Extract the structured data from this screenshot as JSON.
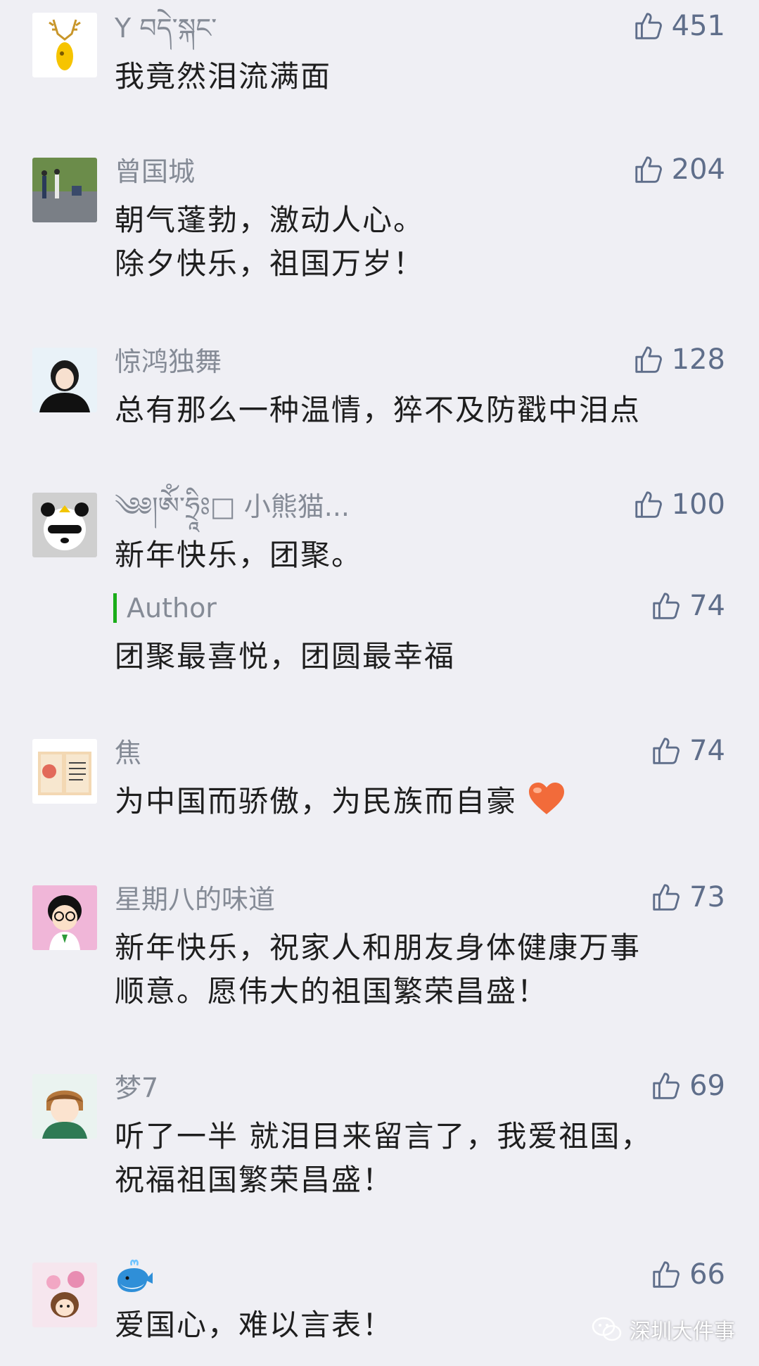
{
  "comments": [
    {
      "nick": "Y བདེ་སྐང་",
      "likes": "451",
      "text": "我竟然泪流满面"
    },
    {
      "nick": "曾国城",
      "likes": "204",
      "text_lines": [
        "朝气蓬勃，激动人心。",
        "除夕快乐，祖国万岁！"
      ]
    },
    {
      "nick": "惊鸿独舞",
      "likes": "128",
      "text": "总有那么一种温情，猝不及防戳中泪点"
    },
    {
      "nick": "༄༅།ཨོཾ་ཧྲཱིཿ□ 小熊猫...",
      "likes": "100",
      "text": "新年快乐，团聚。",
      "reply": {
        "label": "Author",
        "likes": "74",
        "text": "团聚最喜悦，团圆最幸福"
      }
    },
    {
      "nick": "焦",
      "likes": "74",
      "text": "为中国而骄傲，为民族而自豪"
    },
    {
      "nick": "星期八的味道",
      "likes": "73",
      "text_lines": [
        "新年快乐，祝家人和朋友身体健康万事",
        "顺意。愿伟大的祖国繁荣昌盛！"
      ]
    },
    {
      "nick": "梦7",
      "likes": "69",
      "text_lines": [
        "听了一半 就泪目来留言了，我爱祖国，",
        "祝福祖国繁荣昌盛！"
      ]
    },
    {
      "nick": "",
      "likes": "66",
      "text": "爱国心，难以言表！"
    }
  ],
  "watermark": {
    "text": "深圳大件事"
  },
  "colors": {
    "background": "#efeff4",
    "like": "#5f6e8a",
    "nick": "#858b96",
    "author_bar": "#1aad19",
    "heart": "#f26b3a"
  },
  "icons": {
    "like": "thumbs-up-icon",
    "heart": "heart-icon",
    "whale": "whale-icon",
    "watermark": "wechat-icon"
  }
}
